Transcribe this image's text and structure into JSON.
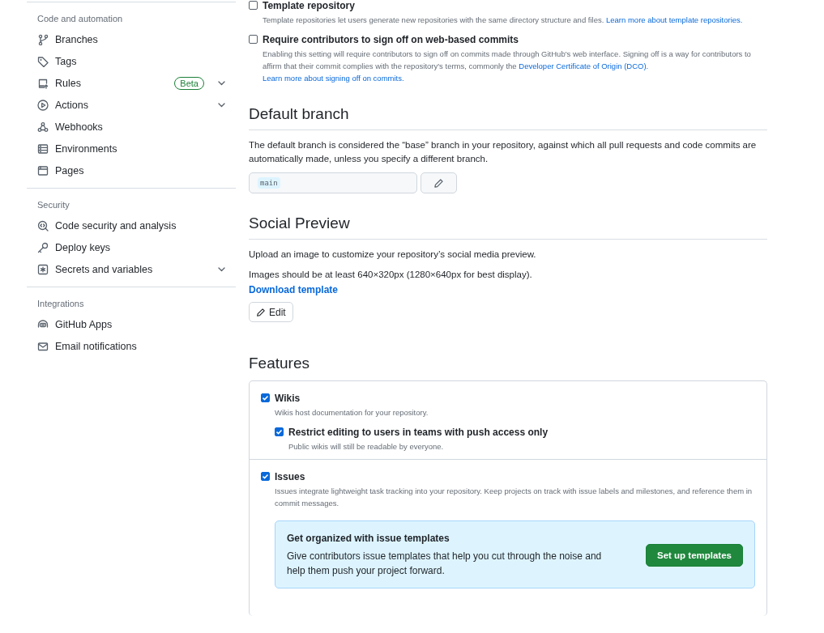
{
  "sidebar": {
    "sections": [
      {
        "heading": "Code and automation",
        "items": [
          {
            "label": "Branches",
            "expandable": false
          },
          {
            "label": "Tags",
            "expandable": false
          },
          {
            "label": "Rules",
            "badge": "Beta",
            "expandable": true
          },
          {
            "label": "Actions",
            "expandable": true
          },
          {
            "label": "Webhooks",
            "expandable": false
          },
          {
            "label": "Environments",
            "expandable": false
          },
          {
            "label": "Pages",
            "expandable": false
          }
        ]
      },
      {
        "heading": "Security",
        "items": [
          {
            "label": "Code security and analysis",
            "expandable": false
          },
          {
            "label": "Deploy keys",
            "expandable": false
          },
          {
            "label": "Secrets and variables",
            "expandable": true
          }
        ]
      },
      {
        "heading": "Integrations",
        "items": [
          {
            "label": "GitHub Apps",
            "expandable": false
          },
          {
            "label": "Email notifications",
            "expandable": false
          }
        ]
      }
    ]
  },
  "general_options": [
    {
      "label": "Template repository",
      "checked": false,
      "description": [
        {
          "text": "Template repositories let users generate new repositories with the same directory structure and files."
        },
        {
          "link": "Learn more about template repositories."
        }
      ]
    },
    {
      "label": "Require contributors to sign off on web-based commits",
      "checked": false,
      "description": [
        {
          "text": "Enabling this setting will require contributors to sign off on commits made through GitHub's web interface. Signing off is a way for contributors to affirm that their commit complies with the repository's terms, commonly the"
        },
        {
          "link": "Developer Certificate of Origin (DCO)."
        },
        {
          "link": "Learn more about signing off on commits."
        }
      ]
    }
  ],
  "default_branch": {
    "title": "Default branch",
    "description": "The default branch is considered the “base” branch in your repository, against which all pull requests and code commits are automatically made, unless you specify a different branch.",
    "branch": "main"
  },
  "social_preview": {
    "title": "Social Preview",
    "description": "Upload an image to customize your repository’s social media preview.",
    "size_note": "Images should be at least 640×320px (1280×640px for best display).",
    "download_link": "Download template",
    "edit_button": "Edit"
  },
  "features": {
    "title": "Features",
    "items": [
      {
        "label": "Wikis",
        "checked": true,
        "description": "Wikis host documentation for your repository.",
        "children": [
          {
            "label": "Restrict editing to users in teams with push access only",
            "checked": true,
            "description": "Public wikis will still be readable by everyone."
          }
        ]
      },
      {
        "label": "Issues",
        "checked": true,
        "description": "Issues integrate lightweight task tracking into your repository. Keep projects on track with issue labels and milestones, and reference them in commit messages.",
        "banner": {
          "title": "Get organized with issue templates",
          "text": "Give contributors issue templates that help you cut through the noise and help them push your project forward.",
          "button": "Set up templates"
        }
      }
    ]
  }
}
